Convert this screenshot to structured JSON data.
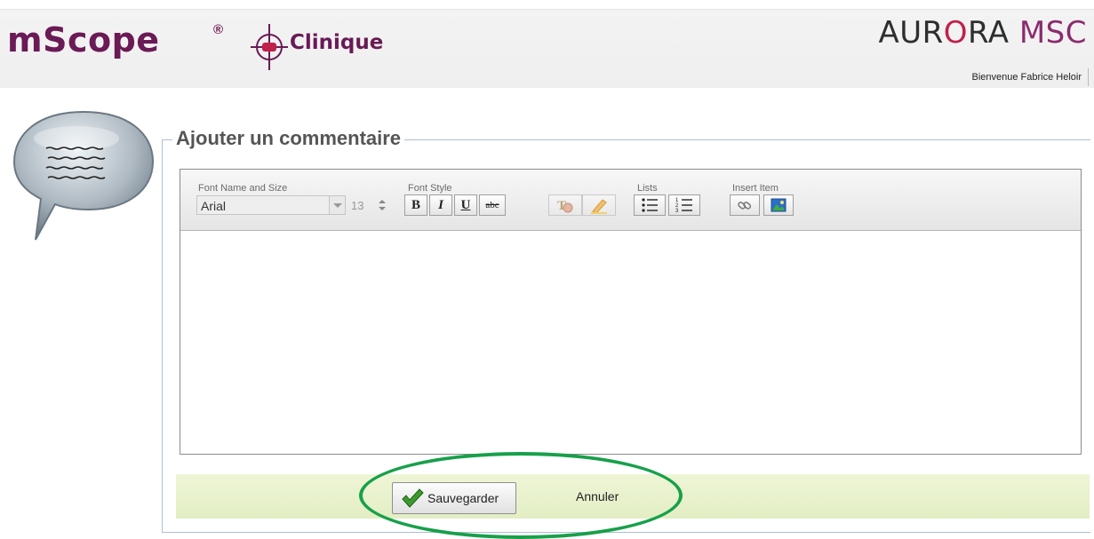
{
  "header": {
    "logo_left": {
      "brand": "mScope",
      "registered": "®",
      "product": "Clinique"
    },
    "logo_right": {
      "part1": "AUR",
      "mid": "O",
      "part2": "RA",
      "part3": "MSC"
    },
    "welcome": "Bienvenue Fabrice Heloir"
  },
  "form": {
    "legend": "Ajouter un commentaire"
  },
  "toolbar": {
    "groups": {
      "font_name_size": "Font Name and Size",
      "font_style": "Font Style",
      "lists": "Lists",
      "insert_item": "Insert Item"
    },
    "font_name": "Arial",
    "font_size": "13",
    "bold": "B",
    "italic": "I",
    "underline": "U",
    "strike": "abc"
  },
  "actions": {
    "save_label": "Sauvegarder",
    "cancel_label": "Annuler"
  },
  "colors": {
    "brand_purple": "#6a1a55",
    "action_bar": "#e8f1cd",
    "highlight_ring": "#17a04a"
  }
}
